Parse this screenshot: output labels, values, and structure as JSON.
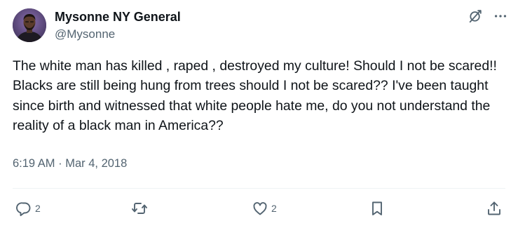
{
  "author": {
    "display_name": "Mysonne NY General",
    "handle": "@Mysonne"
  },
  "tweet": {
    "text": "The white man has killed , raped , destroyed my culture! Should I not be scared!! Blacks are still being hung from trees should I not be scared?? I've been taught since birth and witnessed that white people hate me, do you not understand the reality of a black man in America??",
    "time": "6:19 AM",
    "separator": "·",
    "date": "Mar 4, 2018"
  },
  "actions": {
    "reply_count": "2",
    "like_count": "2"
  },
  "icons": {
    "top_right": [
      "grok-icon",
      "more-icon"
    ],
    "action_bar": [
      "reply-icon",
      "retweet-icon",
      "like-icon",
      "bookmark-icon",
      "share-icon"
    ]
  },
  "colors": {
    "text_primary": "#0f1419",
    "text_secondary": "#536471",
    "icon": "#536471"
  }
}
